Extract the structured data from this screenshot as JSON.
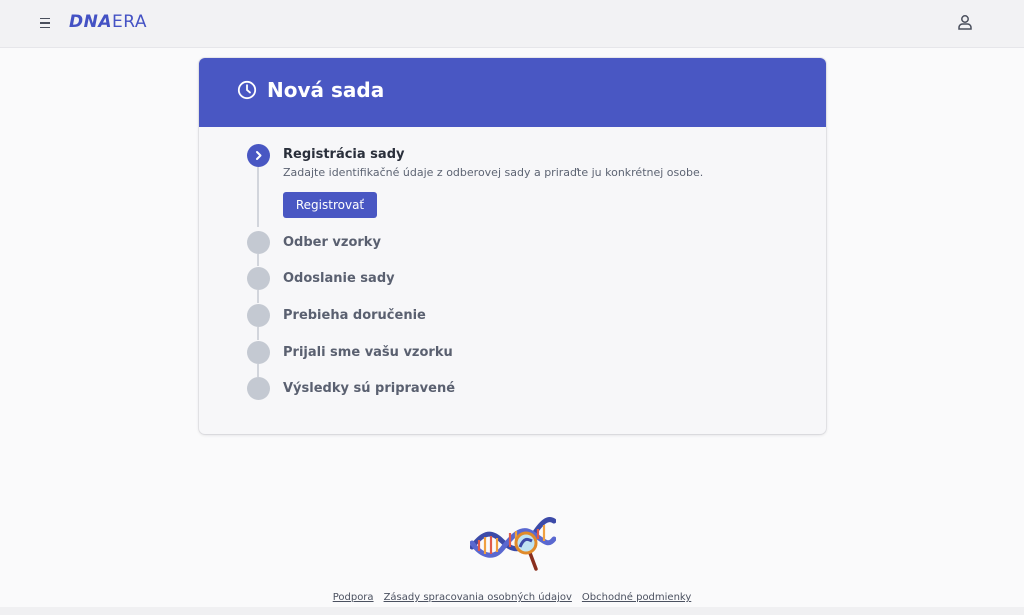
{
  "header": {
    "logo_bold": "DNA",
    "logo_thin": "ERA",
    "menu_icon": "hamburger-icon",
    "user_icon": "user-icon"
  },
  "card": {
    "title": "Nová sada",
    "title_icon": "clock-icon",
    "accent_color": "#4957c3"
  },
  "steps": [
    {
      "title": "Registrácia sady",
      "description": "Zadajte identifikačné údaje z odberovej sady a priraďte ju konkrétnej osobe.",
      "button_label": "Registrovať",
      "state": "active"
    },
    {
      "title": "Odber vzorky",
      "state": "pending"
    },
    {
      "title": "Odoslanie sady",
      "state": "pending"
    },
    {
      "title": "Prebieha doručenie",
      "state": "pending"
    },
    {
      "title": "Prijali sme vašu vzorku",
      "state": "pending"
    },
    {
      "title": "Výsledky sú pripravené",
      "state": "pending"
    }
  ],
  "footer": {
    "links": [
      "Podpora",
      "Zásady spracovania osobných údajov",
      "Obchodné podmienky"
    ]
  }
}
